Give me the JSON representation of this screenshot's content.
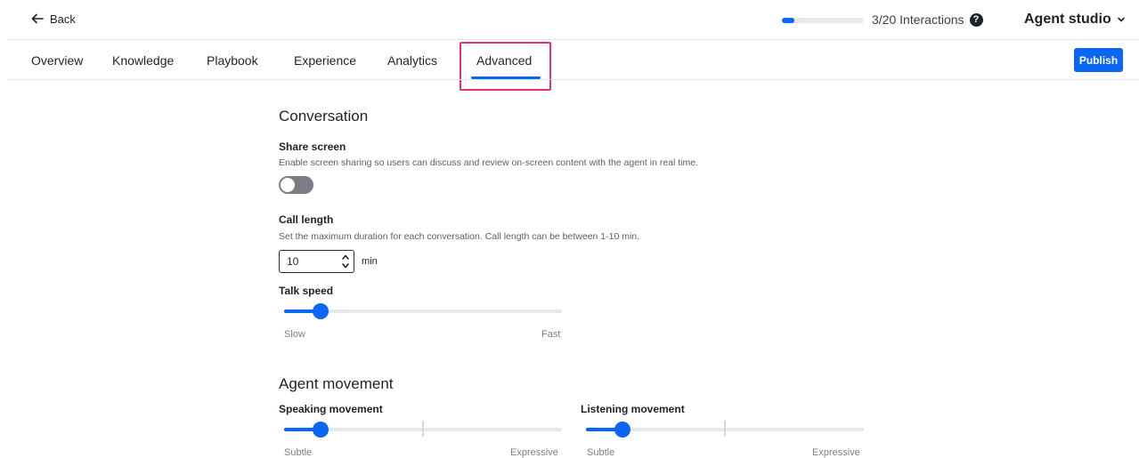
{
  "header": {
    "back_label": "Back",
    "interactions_text": "3/20 Interactions",
    "interactions_progress": 0.15,
    "studio_label": "Agent studio"
  },
  "tabs": [
    {
      "label": "Overview"
    },
    {
      "label": "Knowledge"
    },
    {
      "label": "Playbook"
    },
    {
      "label": "Experience"
    },
    {
      "label": "Analytics"
    },
    {
      "label": "Advanced",
      "active": true
    }
  ],
  "publish_label": "Publish",
  "conversation": {
    "title": "Conversation",
    "share_screen": {
      "label": "Share screen",
      "description": "Enable screen sharing so users can discuss and review on-screen content with the agent in real time.",
      "enabled": false
    },
    "call_length": {
      "label": "Call length",
      "description": "Set the maximum duration for each conversation. Call length can be between 1-10 min.",
      "value": "10",
      "unit": "min"
    },
    "talk_speed": {
      "label": "Talk speed",
      "min_label": "Slow",
      "max_label": "Fast",
      "value": 0.13
    }
  },
  "agent_movement": {
    "title": "Agent movement",
    "speaking": {
      "label": "Speaking movement",
      "min_label": "Subtle",
      "max_label": "Expressive",
      "value": 0.13
    },
    "listening": {
      "label": "Listening movement",
      "min_label": "Subtle",
      "max_label": "Expressive",
      "value": 0.13
    }
  },
  "colors": {
    "accent": "#0a66f5",
    "highlight": "#e0317a"
  }
}
